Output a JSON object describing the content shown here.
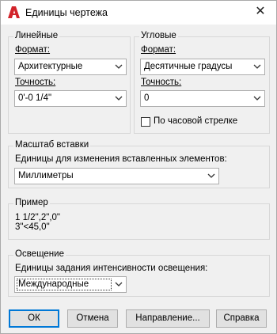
{
  "window": {
    "title": "Единицы чертежа",
    "close_glyph": "✕"
  },
  "linear": {
    "group_label": "Линейные",
    "type_label": "Формат:",
    "type_value": "Архитектурные",
    "precision_label": "Точность:",
    "precision_value": "0'-0 1/4\""
  },
  "angular": {
    "group_label": "Угловые",
    "type_label": "Формат:",
    "type_value": "Десятичные градусы",
    "precision_label": "Точность:",
    "precision_value": "0",
    "clockwise_label": "По часовой стрелке",
    "clockwise_checked": false
  },
  "insertion": {
    "group_label": "Масштаб вставки",
    "units_label": "Единицы для изменения вставленных элементов:",
    "units_value": "Миллиметры"
  },
  "sample": {
    "group_label": "Пример",
    "line1": "1 1/2\",2\",0\"",
    "line2": "3\"<45,0\""
  },
  "lighting": {
    "group_label": "Освещение",
    "units_label": "Единицы задания интенсивности освещения:",
    "units_value": "Международные"
  },
  "buttons": {
    "ok": "ОК",
    "cancel": "Отмена",
    "direction": "Направление...",
    "help": "Справка"
  },
  "colors": {
    "accent": "#0078d7",
    "app_icon": "#d2232a"
  }
}
